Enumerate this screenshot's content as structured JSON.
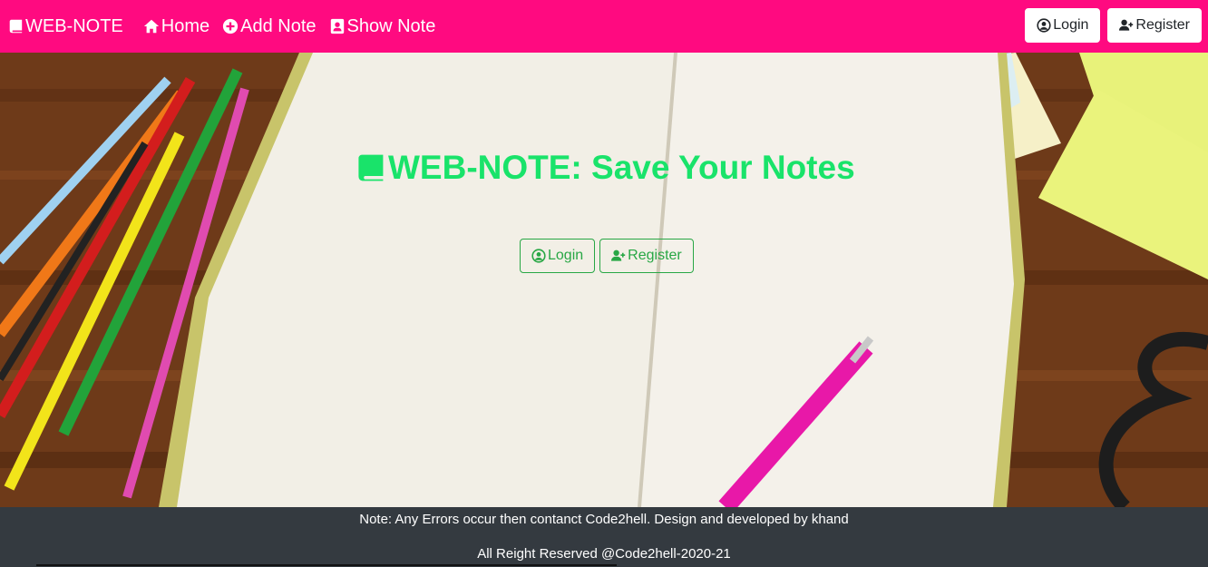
{
  "navbar": {
    "brand": "WEB-NOTE",
    "links": [
      {
        "label": "Home",
        "icon": "home-icon"
      },
      {
        "label": "Add Note",
        "icon": "plus-circle-icon"
      },
      {
        "label": "Show Note",
        "icon": "address-book-icon"
      }
    ],
    "login_label": "Login",
    "register_label": "Register"
  },
  "hero": {
    "title": "WEB-NOTE: Save Your Notes",
    "login_label": "Login",
    "register_label": "Register"
  },
  "footer": {
    "line1": "Note: Any Errors occur then contanct Code2hell. Design and developed by khand",
    "line2": "All Reight Reserved @Code2hell-2020-21"
  },
  "colors": {
    "navbar": "#ff0a80",
    "title": "#19e36a",
    "accent_green": "#28a745",
    "footer": "#343a40"
  }
}
